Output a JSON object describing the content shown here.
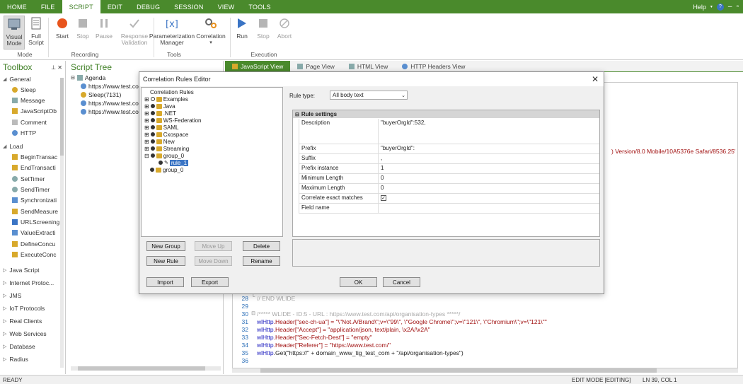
{
  "menu": {
    "tabs": [
      "HOME",
      "FILE",
      "SCRIPT",
      "EDIT",
      "DEBUG",
      "SESSION",
      "VIEW",
      "TOOLS"
    ],
    "active": "SCRIPT",
    "help": "Help"
  },
  "ribbon": {
    "visual_mode": "Visual Mode",
    "full_script": "Full Script",
    "mode_group": "Mode",
    "start": "Start",
    "stop": "Stop",
    "pause": "Pause",
    "response_validation": "Response Validation",
    "recording_group": "Recording",
    "param_manager": "Parameterization Manager",
    "correlation": "Correlation",
    "tools_group": "Tools",
    "run": "Run",
    "run_stop": "Stop",
    "abort": "Abort",
    "execution_group": "Execution"
  },
  "toolbox": {
    "title": "Toolbox",
    "general_label": "General",
    "general_items": [
      "Sleep",
      "Message",
      "JavaScriptOb",
      "Comment",
      "HTTP"
    ],
    "load_label": "Load",
    "load_items": [
      "BeginTransac",
      "EndTransacti",
      "SetTimer",
      "SendTimer",
      "Synchronizati",
      "SendMeasure",
      "URLScreening",
      "ValueExtracti",
      "DefineConcu",
      "ExecuteConc"
    ],
    "categories": [
      "Java Script",
      "Internet Protoc...",
      "JMS",
      "IoT Protocols",
      "Real Clients",
      "Web Services",
      "Database",
      "Radius"
    ]
  },
  "script_tree": {
    "title": "Script Tree",
    "root": "Agenda",
    "items": [
      "https://www.test.co",
      "Sleep(7131)",
      "https://www.test.co",
      "https://www.test.co"
    ]
  },
  "editor": {
    "tabs": [
      "JavaScript View",
      "Page View",
      "HTML View",
      "HTTP Headers View"
    ],
    "active_tab": "JavaScript View",
    "partial_line": ") Version/8.0 Mobile/10A5376e Safari/8536.25'",
    "lines": [
      {
        "n": "28",
        "text": "// END WLIDE"
      },
      {
        "n": "29",
        "text": ""
      },
      {
        "n": "30",
        "text": "/***** WLIDE - ID:5 - URL : https://www.test.com/api/organisation-types *****/"
      },
      {
        "n": "31",
        "obj": "wlHttp",
        "text": ".Header[\"sec-ch-ua\"] = \"\\\"Not.A/Brand\\\";v=\\\"99\\\", \\\"Google Chrome\\\";v=\\\"121\\\", \\\"Chromium\\\";v=\\\"121\\\"\""
      },
      {
        "n": "32",
        "obj": "wlHttp",
        "text": ".Header[\"Accept\"] = \"application/json, text/plain, \\x2A/\\x2A\""
      },
      {
        "n": "33",
        "obj": "wlHttp",
        "text": ".Header[\"Sec-Fetch-Dest\"] = \"empty\""
      },
      {
        "n": "34",
        "obj": "wlHttp",
        "text": ".Header[\"Referer\"] = \"https://www.test.com/\""
      },
      {
        "n": "35",
        "obj": "wlHttp",
        "text": ".Get(\"https://\" + domain_www_tig_test_com + \"/api/organisation-types\")"
      },
      {
        "n": "36",
        "text": ""
      }
    ]
  },
  "dialog": {
    "title": "Correlation Rules Editor",
    "tree_root": "Correlation Rules",
    "tree_items": [
      "Examples",
      "Java",
      ".NET",
      "WS-Federation",
      "SAML",
      "Cxospace",
      "New",
      "Streaming",
      "group_0"
    ],
    "rule_child": "rule_1",
    "last_group": "group_0",
    "rule_type_label": "Rule type:",
    "rule_type_value": "All body text",
    "settings_title": "Rule settings",
    "settings": [
      {
        "key": "Description",
        "value": "\"buyerOrgId\":532,"
      },
      {
        "key": "Prefix",
        "value": "\"buyerOrgId\":"
      },
      {
        "key": "Suffix",
        "value": ","
      },
      {
        "key": "Prefix instance",
        "value": "1"
      },
      {
        "key": "Minimum Length",
        "value": "0"
      },
      {
        "key": "Maximum Length",
        "value": "0"
      },
      {
        "key": "Correlate exact matches",
        "value": ""
      },
      {
        "key": "Field name",
        "value": ""
      }
    ],
    "buttons": {
      "new_group": "New Group",
      "move_up": "Move Up",
      "delete": "Delete",
      "new_rule": "New Rule",
      "move_down": "Move Down",
      "rename": "Rename",
      "import": "Import",
      "export": "Export",
      "ok": "OK",
      "cancel": "Cancel"
    }
  },
  "status": {
    "left": "READY",
    "mode": "EDIT MODE [EDITING]",
    "position": "LN 39, COL 1"
  }
}
